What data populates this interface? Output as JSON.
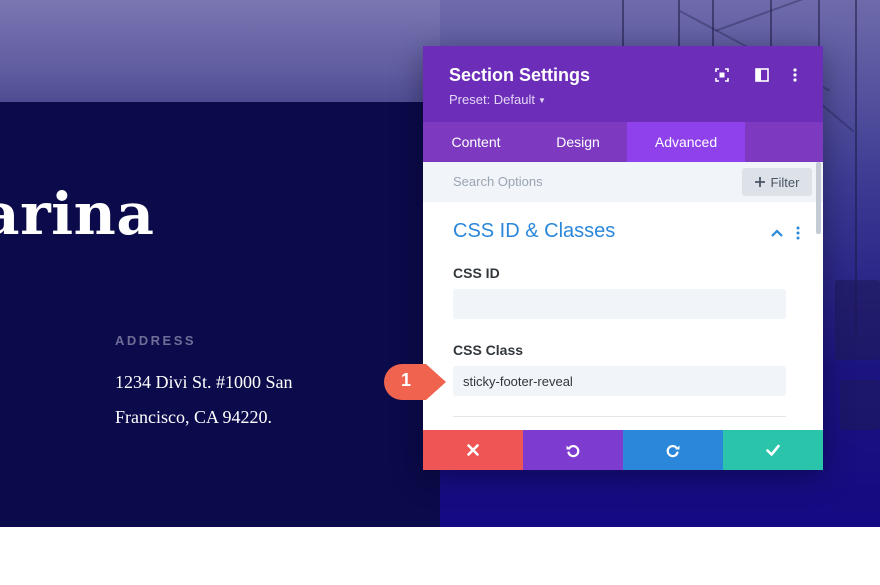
{
  "hero": {
    "title": "arina",
    "address_label": "ADDRESS",
    "address_line1": "1234 Divi St. #1000 San",
    "address_line2": "Francisco, CA 94220."
  },
  "modal": {
    "title": "Section Settings",
    "preset": "Preset: Default",
    "header_icons": [
      "fullscreen-icon",
      "split-view-icon",
      "more-options-icon"
    ],
    "tabs": [
      {
        "label": "Content",
        "active": false
      },
      {
        "label": "Design",
        "active": false
      },
      {
        "label": "Advanced",
        "active": true
      }
    ],
    "search_placeholder": "Search Options",
    "filter_label": "Filter",
    "section_title": "CSS ID & Classes",
    "fields": [
      {
        "label": "CSS ID",
        "value": ""
      },
      {
        "label": "CSS Class",
        "value": "sticky-footer-reveal"
      }
    ],
    "actions": [
      {
        "name": "discard",
        "icon": "close-icon",
        "color": "#ef5555"
      },
      {
        "name": "undo",
        "icon": "undo-icon",
        "color": "#7e3bd0"
      },
      {
        "name": "redo",
        "icon": "redo-icon",
        "color": "#2b87da"
      },
      {
        "name": "save",
        "icon": "check-icon",
        "color": "#29c4a9"
      }
    ]
  },
  "callout": {
    "number": "1",
    "color": "#f0634e"
  },
  "colors": {
    "header_purple": "#6c2eb9",
    "tab_bar": "#7d3ac1",
    "active_tab": "#8f42ec",
    "section_title_blue": "#2b87da",
    "dark_navy": "#0b0a4b"
  }
}
